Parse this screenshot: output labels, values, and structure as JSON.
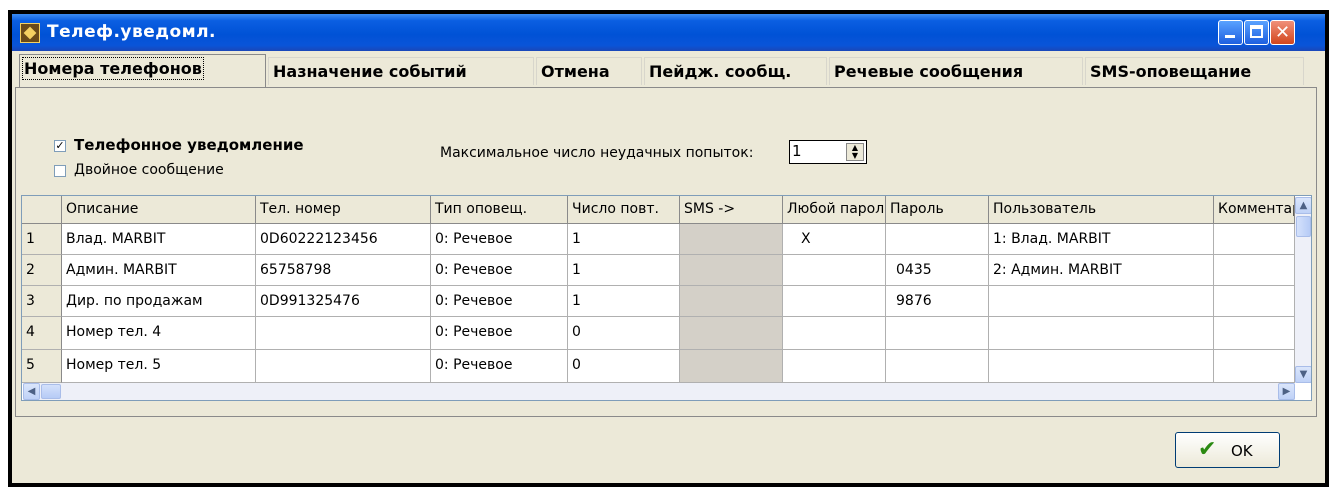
{
  "window": {
    "title": "Телеф.уведомл."
  },
  "tabs": [
    {
      "label": "Номера телефонов"
    },
    {
      "label": "Назначение событий"
    },
    {
      "label": "Отмена"
    },
    {
      "label": "Пейдж. сообщ."
    },
    {
      "label": "Речевые сообщения"
    },
    {
      "label": "SMS-оповещание"
    }
  ],
  "options": {
    "phone_notification": {
      "label": "Телефонное уведомление",
      "checked": true
    },
    "double_message": {
      "label": "Двойное сообщение",
      "checked": false
    },
    "max_attempts_label": "Максимальное число неудачных попыток:",
    "max_attempts_value": "1"
  },
  "table": {
    "headers": [
      "Описание",
      "Тел. номер",
      "Тип оповещ.",
      "Число повт.",
      "SMS ->",
      "Любой пароль",
      "Пароль",
      "Пользователь",
      "Комментарий"
    ],
    "rows": [
      {
        "num": "1",
        "desc": "Влад. MARBIT",
        "phone": "0D60222123456",
        "type": "0: Речевое",
        "repeat": "1",
        "sms": "",
        "any": "X",
        "pwd": "",
        "user": "1: Влад. MARBIT",
        "comment": ""
      },
      {
        "num": "2",
        "desc": "Админ. MARBIT",
        "phone": "65758798",
        "type": "0: Речевое",
        "repeat": "1",
        "sms": "",
        "any": "",
        "pwd": "0435",
        "user": "2: Админ. MARBIT",
        "comment": ""
      },
      {
        "num": "3",
        "desc": "Дир. по продажам",
        "phone": "0D991325476",
        "type": "0: Речевое",
        "repeat": "1",
        "sms": "",
        "any": "",
        "pwd": "9876",
        "user": "",
        "comment": ""
      },
      {
        "num": "4",
        "desc": "Номер тел. 4",
        "phone": "",
        "type": "0: Речевое",
        "repeat": "0",
        "sms": "",
        "any": "",
        "pwd": "",
        "user": "",
        "comment": ""
      },
      {
        "num": "5",
        "desc": "Номер тел. 5",
        "phone": "",
        "type": "0: Речевое",
        "repeat": "0",
        "sms": "",
        "any": "",
        "pwd": "",
        "user": "",
        "comment": ""
      }
    ]
  },
  "footer": {
    "ok_label": "OK"
  },
  "colors": {
    "titlebar": "#0052d6",
    "face": "#ece9d8",
    "ok_check": "#2b8a12"
  }
}
